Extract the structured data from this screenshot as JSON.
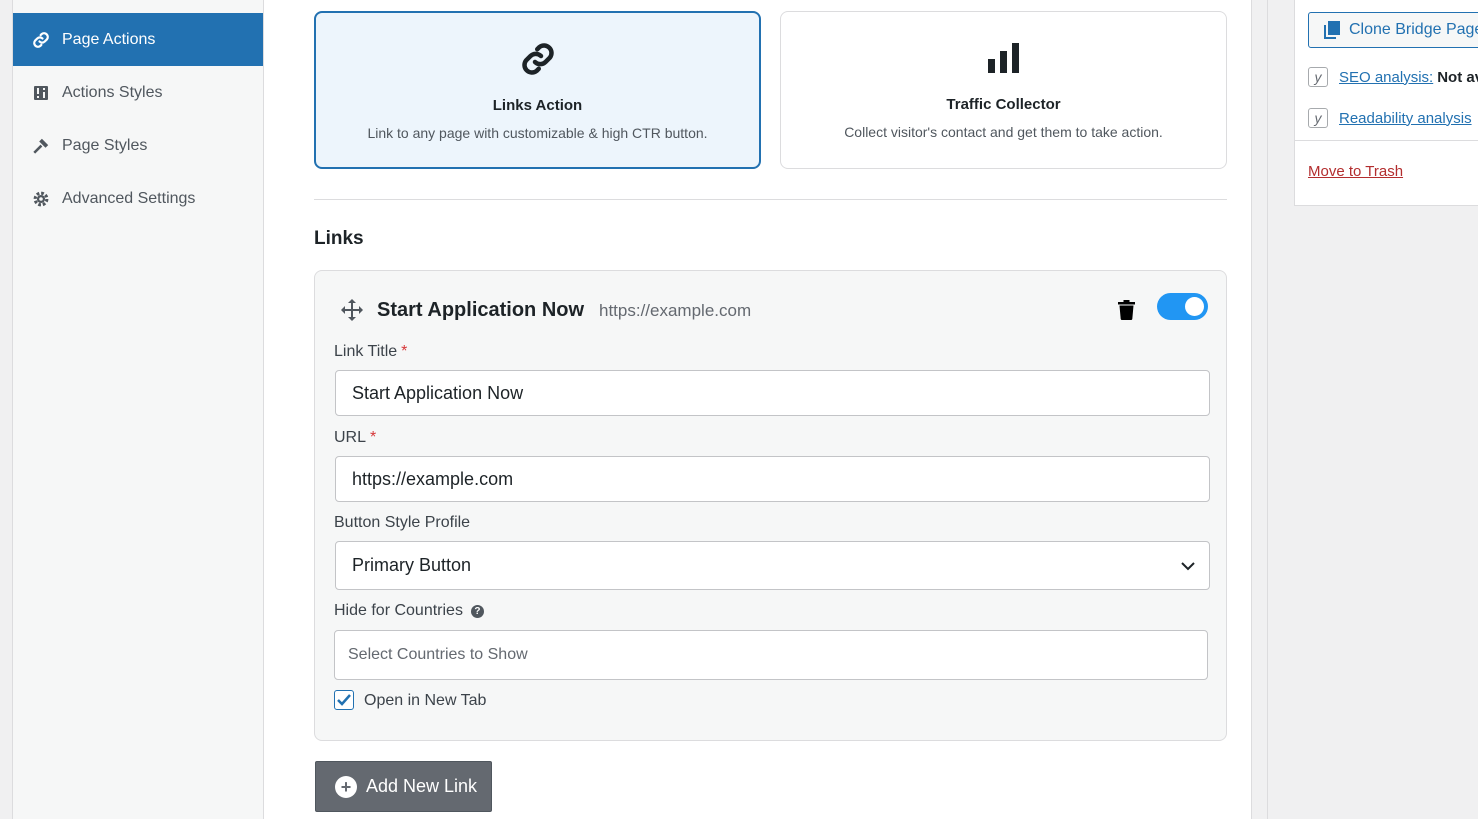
{
  "sidebar": {
    "items": [
      {
        "label": "Page Actions",
        "icon": "link-icon",
        "active": true
      },
      {
        "label": "Actions Styles",
        "icon": "sliders-icon",
        "active": false
      },
      {
        "label": "Page Styles",
        "icon": "hammer-icon",
        "active": false
      },
      {
        "label": "Advanced Settings",
        "icon": "gear-icon",
        "active": false
      }
    ]
  },
  "action_types": [
    {
      "title": "Links Action",
      "description": "Link to any page with customizable & high CTR button.",
      "icon": "link-icon",
      "selected": true
    },
    {
      "title": "Traffic Collector",
      "description": "Collect visitor's contact and get them to take action.",
      "icon": "bar-chart-icon",
      "selected": false
    }
  ],
  "links_section": {
    "title": "Links",
    "link": {
      "header_title": "Start Application Now",
      "header_url": "https://example.com",
      "enabled": true,
      "fields": {
        "link_title_label": "Link Title",
        "link_title_value": "Start Application Now",
        "url_label": "URL",
        "url_value": "https://example.com",
        "required_mark": "*",
        "button_style_label": "Button Style Profile",
        "button_style_value": "Primary Button",
        "hide_countries_label": "Hide for Countries",
        "help_mark": "?",
        "hide_countries_placeholder": "Select Countries to Show",
        "open_new_tab_label": "Open in New Tab",
        "open_new_tab_checked": true
      }
    },
    "add_button_label": "Add New Link",
    "add_button_icon": "+"
  },
  "publish_box": {
    "clone_button_label": "Clone Bridge Page",
    "seo_label": "SEO analysis:",
    "seo_value": "Not available",
    "readability_label": "Readability analysis",
    "yoast_mark": "y",
    "trash_label": "Move to Trash"
  },
  "colors": {
    "accent": "#2271b1",
    "toggle": "#2196f3",
    "danger": "#b32d2e",
    "button_gray": "#646970"
  }
}
